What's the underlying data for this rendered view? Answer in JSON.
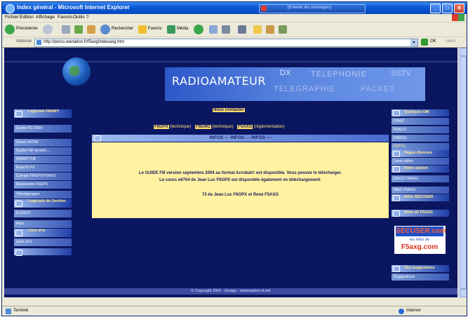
{
  "window": {
    "title": "Index général - Microsoft Internet Explorer",
    "taskbar_tab": "[Enlever les messages]",
    "min_glyph": "_",
    "max_glyph": "□",
    "close_glyph": "✕"
  },
  "menu": [
    "Fichier",
    "Edition",
    "Affichage",
    "Favoris",
    "Outils",
    "?"
  ],
  "toolbar": {
    "back_label": "Précédente",
    "search_label": "Rechercher",
    "favorites_label": "Favoris",
    "media_label": "Média"
  },
  "address": {
    "label": "Adresse",
    "url": "http://perso.wanadoo.fr/f5axg/indexaxg.htm",
    "go_label": "OK",
    "links_label": "Liens"
  },
  "banner": {
    "main": "RADIOAMATEUR",
    "dx": "DX",
    "telephonie": "TELEPHONIE",
    "sstv": "SSTV",
    "telegraphie": "TELEGRAPHIE",
    "packet": "PACKET"
  },
  "left_sidebar": {
    "section1_title": "Logiciels F6AWY",
    "section1_items": [
      "Guide FD 2004",
      "Cours e6704",
      "Guide FØ version...",
      "F6AWY FØ",
      "Exam'5 FX",
      "Corrigé F6GPX/F6AXG",
      "Raisonatis F6GPX",
      "Témoignages"
    ],
    "section2_title": "Logiciels de Gestion",
    "section2_items": [
      "G.DXCC",
      "Actu"
    ],
    "section3_title": "Livre d'or",
    "section3_items": [
      "Livre d'or"
    ]
  },
  "right_sidebar": {
    "section1_title": "Quelques OM",
    "section1_items": [
      "F5NIZ",
      "F6ALO",
      "F6EEQ",
      "F6TTV"
    ],
    "section2_title": "Pages diverses",
    "section2_items": [
      "Liens utiles"
    ],
    "section3_title": "Notre station",
    "section3_items": [
      "DXCC F5AXG",
      "WAZ F5AXG"
    ],
    "section4_title": "Infos SECUSER",
    "section5_title": "Infos de F5AXG",
    "section6_title": "Vos suggestions",
    "section6_items": [
      "Suggestions"
    ],
    "ad_top": "SECUSER.com",
    "ad_mid": "les infos de",
    "ad_bottom": "F5axg.com"
  },
  "center": {
    "contact": "Nous contacter",
    "links": [
      {
        "tag": "F6GPX",
        "text": "(technique)"
      },
      {
        "tag": "F6EMO",
        "text": "(technique)"
      },
      {
        "tag": "F5AXG",
        "text": "(réglementation)"
      }
    ],
    "infos_title": "INFOS --- INFOS --- INFOS ---",
    "line1": "Le GUIDE FØ version septembre 2004 au format Acrobat© est disponible. Vous pouvez le télécharger.",
    "line2": "Le cours e6704 de Jean Luc F6GPX est disponible également en téléchargement.",
    "line3": "73 de Jean Luc F6GPX et René F5AXG"
  },
  "footer": "© Copyright 2002 - Design : webmasters-fr.net",
  "status": {
    "left": "Terminé",
    "zone": "Internet"
  }
}
